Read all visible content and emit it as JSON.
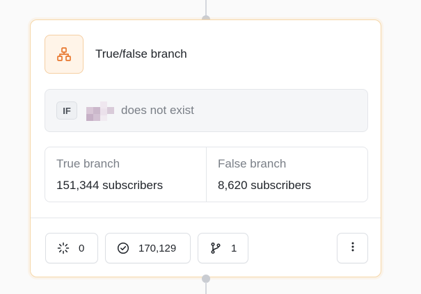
{
  "node": {
    "title": "True/false branch",
    "icon": "branch-tree-icon",
    "accent": "#e8772e"
  },
  "condition": {
    "keyword": "IF",
    "text": "does not exist"
  },
  "branches": [
    {
      "label": "True branch",
      "count": "151,344 subscribers"
    },
    {
      "label": "False branch",
      "count": "8,620 subscribers"
    }
  ],
  "footer": {
    "pending": {
      "icon": "loading-spinner-icon",
      "value": "0"
    },
    "completed": {
      "icon": "check-circle-icon",
      "value": "170,129"
    },
    "branches": {
      "icon": "git-branch-icon",
      "value": "1"
    },
    "more": {
      "icon": "more-vertical-icon"
    }
  }
}
